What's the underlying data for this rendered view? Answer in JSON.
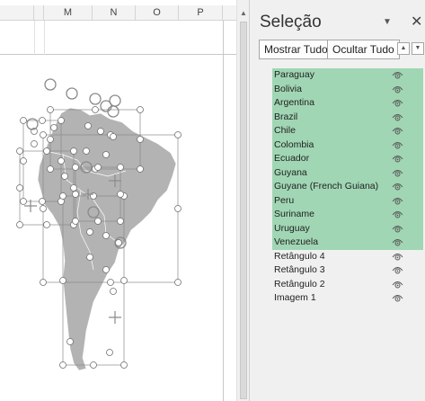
{
  "columns": [
    {
      "label": "",
      "name": "col-k"
    },
    {
      "label": "",
      "name": "col-l"
    },
    {
      "label": "M",
      "name": "col-m"
    },
    {
      "label": "N",
      "name": "col-n"
    },
    {
      "label": "O",
      "name": "col-o"
    },
    {
      "label": "P",
      "name": "col-p"
    }
  ],
  "pane": {
    "title": "Seleção",
    "menu_icon": "triangle-down-icon",
    "close_icon": "close-icon",
    "show_all": "Mostrar Tudo",
    "hide_all": "Ocultar Tudo",
    "bring_forward_icon": "chevron-up-icon",
    "send_backward_icon": "chevron-down-icon",
    "items": [
      {
        "label": "Paraguay",
        "selected": true,
        "icon": "eye-icon"
      },
      {
        "label": "Bolivia",
        "selected": true,
        "icon": "eye-icon"
      },
      {
        "label": "Argentina",
        "selected": true,
        "icon": "eye-icon"
      },
      {
        "label": "Brazil",
        "selected": true,
        "icon": "eye-icon"
      },
      {
        "label": "Chile",
        "selected": true,
        "icon": "eye-icon"
      },
      {
        "label": "Colombia",
        "selected": true,
        "icon": "eye-icon"
      },
      {
        "label": "Ecuador",
        "selected": true,
        "icon": "eye-icon"
      },
      {
        "label": "Guyana",
        "selected": true,
        "icon": "eye-icon"
      },
      {
        "label": "Guyane (French Guiana)",
        "selected": true,
        "icon": "eye-icon"
      },
      {
        "label": "Peru",
        "selected": true,
        "icon": "eye-icon"
      },
      {
        "label": "Suriname",
        "selected": true,
        "icon": "eye-icon"
      },
      {
        "label": "Uruguay",
        "selected": true,
        "icon": "eye-icon"
      },
      {
        "label": "Venezuela",
        "selected": true,
        "icon": "eye-icon"
      },
      {
        "label": "Retângulo 4",
        "selected": false,
        "icon": "eye-icon"
      },
      {
        "label": "Retângulo 3",
        "selected": false,
        "icon": "eye-icon"
      },
      {
        "label": "Retângulo 2",
        "selected": false,
        "icon": "eye-icon"
      },
      {
        "label": "Imagem 1",
        "selected": false,
        "icon": "eye-icon"
      }
    ]
  },
  "colors": {
    "selected_row": "#a0d6b4",
    "pane_bg": "#f0f0f0",
    "map_fill": "#b3b3b3"
  }
}
